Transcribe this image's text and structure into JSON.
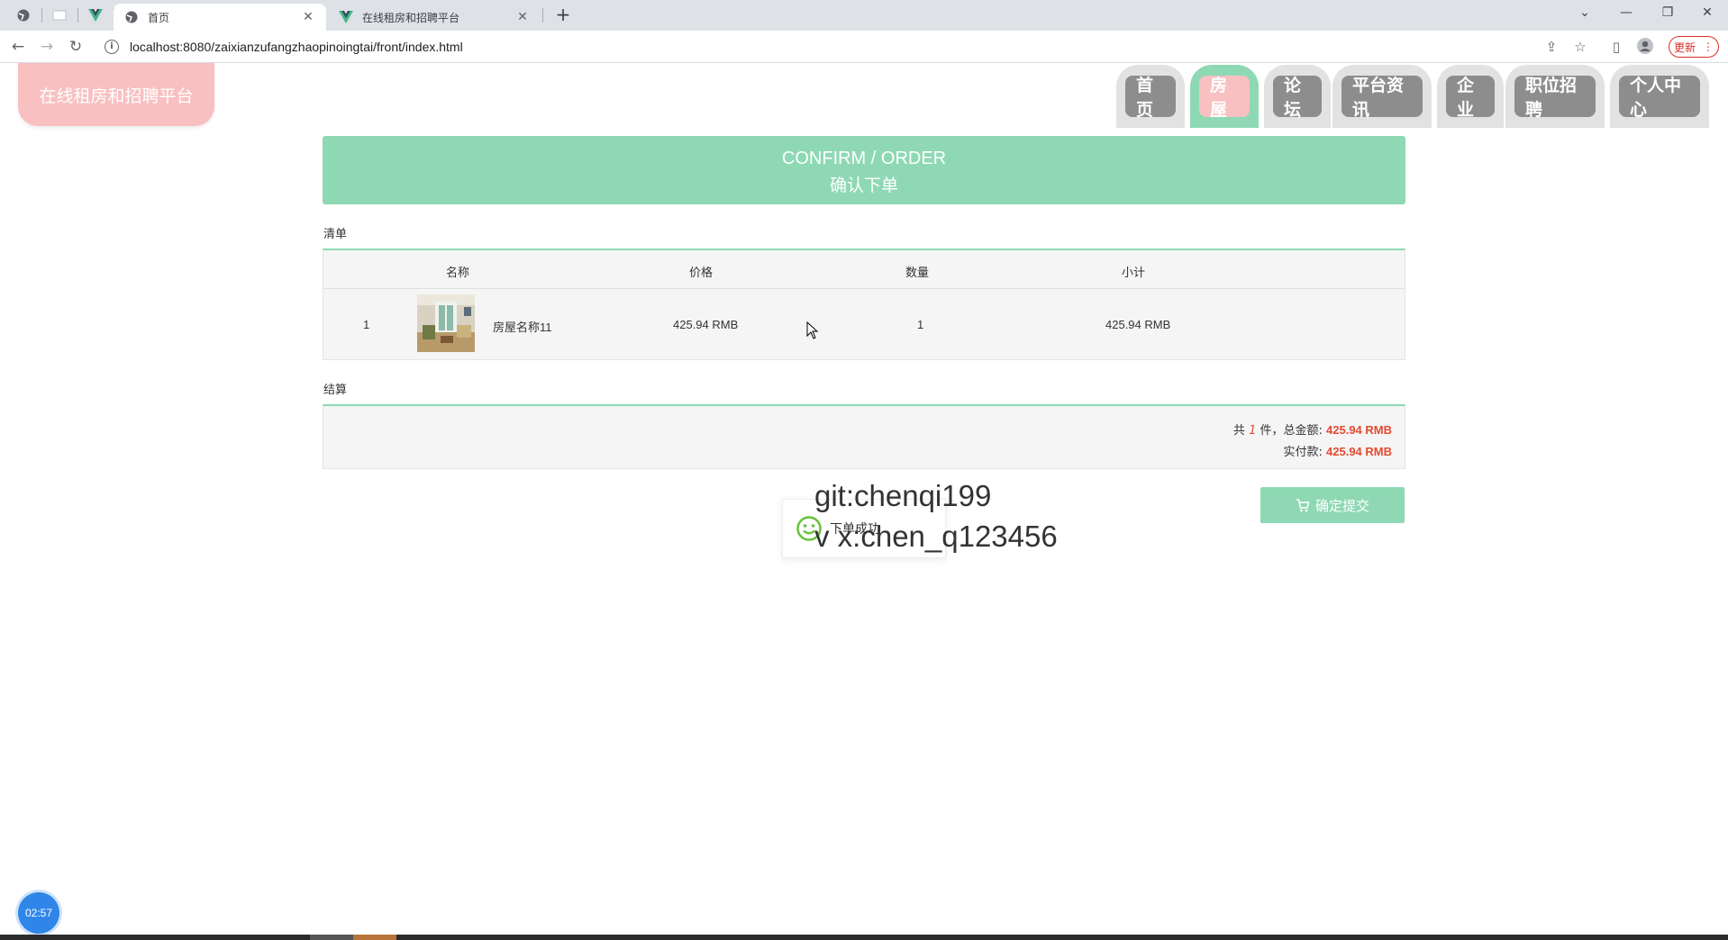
{
  "browser": {
    "tabs": [
      {
        "title": "首页",
        "active": true
      },
      {
        "title": "在线租房和招聘平台",
        "active": false
      }
    ],
    "url": "localhost:8080/zaixianzufangzhaopinoingtai/front/index.html",
    "update_label": "更新"
  },
  "site": {
    "logo": "在线租房和招聘平台",
    "nav": [
      {
        "label": "首页",
        "active": false
      },
      {
        "label": "房屋",
        "active": true
      },
      {
        "label": "论坛",
        "active": false
      },
      {
        "label": "平台资讯",
        "active": false
      },
      {
        "label": "企业",
        "active": false
      },
      {
        "label": "职位招聘",
        "active": false
      },
      {
        "label": "个人中心",
        "active": false
      }
    ]
  },
  "banner": {
    "en": "CONFIRM / ORDER",
    "cn": "确认下单"
  },
  "list": {
    "section_label": "清单",
    "headers": [
      "名称",
      "价格",
      "数量",
      "小计"
    ],
    "rows": [
      {
        "index": "1",
        "name": "房屋名称11",
        "price": "425.94 RMB",
        "qty": "1",
        "subtotal": "425.94 RMB"
      }
    ]
  },
  "settlement": {
    "section_label": "结算",
    "line1_prefix": "共",
    "count": "1",
    "line1_mid": "件，总金额:",
    "total": "425.94 RMB",
    "line2_prefix": "实付款:",
    "paid": "425.94 RMB"
  },
  "submit_label": "确定提交",
  "toast": {
    "text": "下单成功"
  },
  "watermark": {
    "line1": "git:chenqi199",
    "line2": "v x:chen_q123456"
  },
  "clock": "02:57",
  "colors": {
    "accent_green": "#8ed9b3",
    "accent_pink": "#f8c0c1",
    "price_red": "#e54a2f"
  }
}
